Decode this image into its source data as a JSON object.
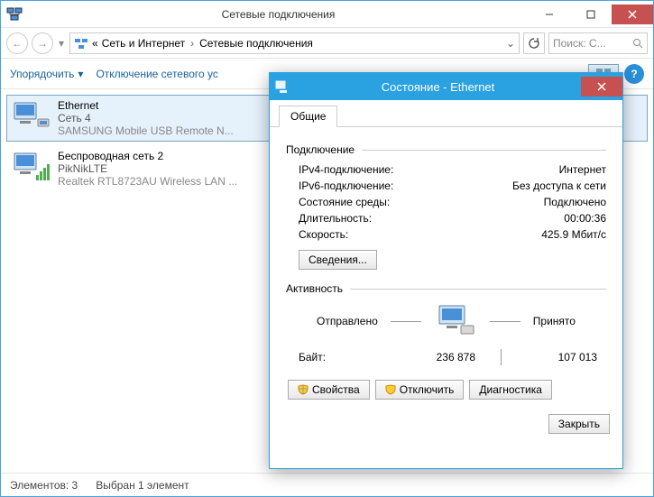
{
  "window": {
    "title": "Сетевые подключения"
  },
  "breadcrumb": {
    "prefix": "«",
    "seg1": "Сеть и Интернет",
    "seg2": "Сетевые подключения"
  },
  "search": {
    "placeholder": "Поиск: С..."
  },
  "toolbar": {
    "organize": "Упорядочить",
    "disable": "Отключение сетевого ус"
  },
  "adapters": [
    {
      "name": "Ethernet",
      "net": "Сеть  4",
      "dev": "SAMSUNG Mobile USB Remote N..."
    },
    {
      "name": "Беспроводная сеть 2",
      "net": "PikNikLTE",
      "dev": "Realtek RTL8723AU Wireless LAN ..."
    }
  ],
  "statusbar": {
    "count_label": "Элементов:",
    "count": "3",
    "selected": "Выбран 1 элемент"
  },
  "dialog": {
    "title": "Состояние - Ethernet",
    "tab": "Общие",
    "connection": {
      "header": "Подключение",
      "ipv4_k": "IPv4-подключение:",
      "ipv4_v": "Интернет",
      "ipv6_k": "IPv6-подключение:",
      "ipv6_v": "Без доступа к сети",
      "media_k": "Состояние среды:",
      "media_v": "Подключено",
      "duration_k": "Длительность:",
      "duration_v": "00:00:36",
      "speed_k": "Скорость:",
      "speed_v": "425.9 Мбит/с",
      "details_btn": "Сведения..."
    },
    "activity": {
      "header": "Активность",
      "sent_label": "Отправлено",
      "recv_label": "Принято",
      "bytes_label": "Байт:",
      "sent": "236 878",
      "recv": "107 013"
    },
    "buttons": {
      "properties": "Свойства",
      "disable": "Отключить",
      "diagnose": "Диагностика",
      "close": "Закрыть"
    }
  }
}
